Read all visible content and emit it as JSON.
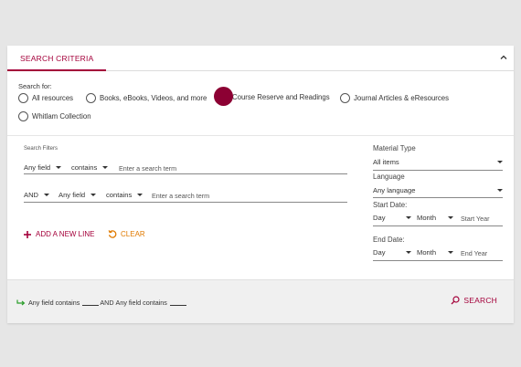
{
  "tab": {
    "label": "SEARCH CRITERIA"
  },
  "search_for": {
    "label": "Search for:",
    "options": [
      {
        "label": "All resources"
      },
      {
        "label": "Books, eBooks, Videos, and more"
      },
      {
        "label": "Course Reserve and Readings"
      },
      {
        "label": "Journal Articles & eResources"
      },
      {
        "label": "Whitlam Collection"
      }
    ]
  },
  "filters": {
    "label": "Search Filters",
    "line1": {
      "field": "Any field",
      "operator": "contains",
      "placeholder": "Enter a search term"
    },
    "line2": {
      "boolean": "AND",
      "field": "Any field",
      "operator": "contains",
      "placeholder": "Enter a search term"
    },
    "add_line": "ADD A NEW LINE",
    "clear": "CLEAR"
  },
  "material_type": {
    "label": "Material Type",
    "value": "All items"
  },
  "language": {
    "label": "Language",
    "value": "Any language"
  },
  "start_date": {
    "label": "Start Date:",
    "day": "Day",
    "month": "Month",
    "year_placeholder": "Start Year"
  },
  "end_date": {
    "label": "End Date:",
    "day": "Day",
    "month": "Month",
    "year_placeholder": "End Year"
  },
  "query_summary": {
    "part1": "Any field",
    "part2": "contains",
    "and": "AND",
    "part3": "Any field",
    "part4": "contains"
  },
  "search_button": "SEARCH",
  "colors": {
    "accent": "#a4003a",
    "clear": "#e07a00",
    "arrow": "#2a9d2a"
  }
}
